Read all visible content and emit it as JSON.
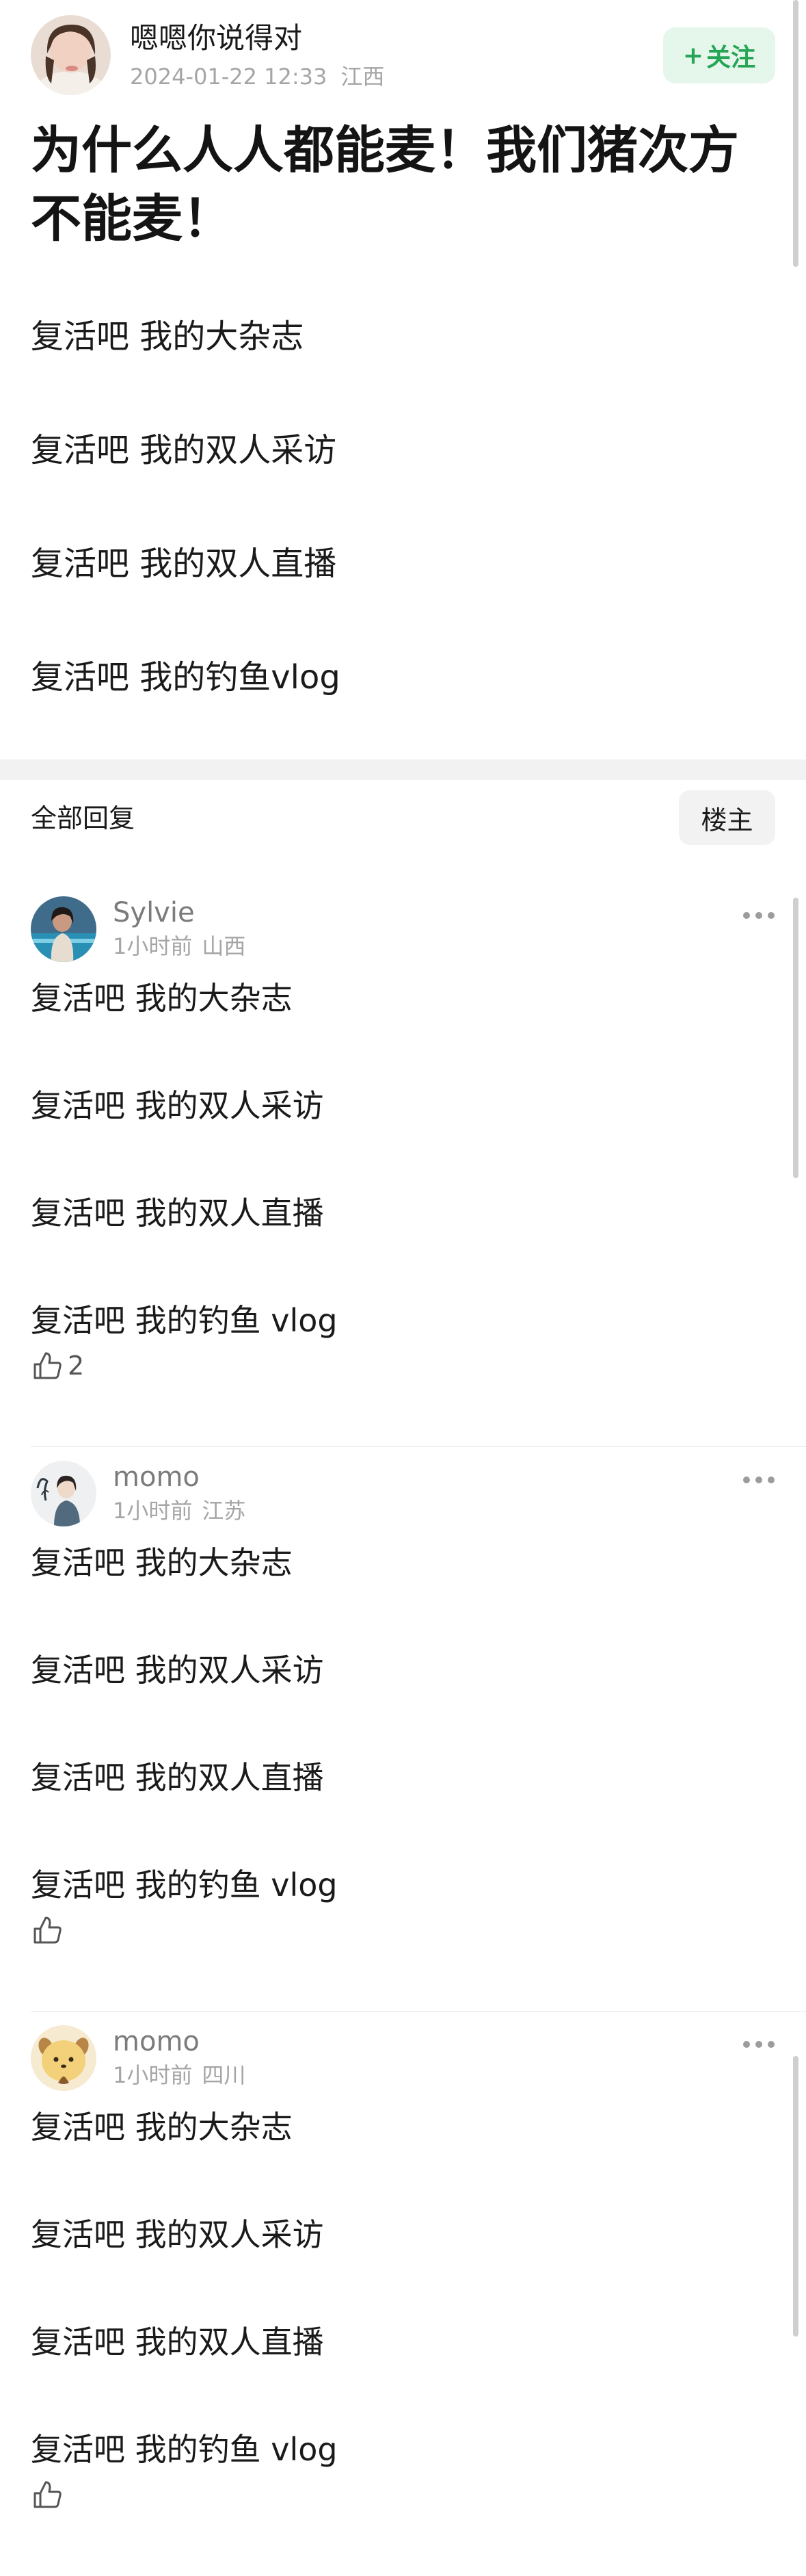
{
  "post": {
    "author": "嗯嗯你说得对",
    "date": "2024-01-22 12:33",
    "location": "江西",
    "follow_label": "关注",
    "follow_plus": "+",
    "title": "为什么人人都能麦！我们猪次方不能麦！",
    "lines": [
      "复活吧 我的大杂志",
      "复活吧 我的双人采访",
      "复活吧 我的双人直播",
      "复活吧 我的钓鱼vlog"
    ]
  },
  "replies": {
    "section_title": "全部回复",
    "op_filter_label": "楼主",
    "items": [
      {
        "author": "Sylvie",
        "time": "1小时前",
        "location": "山西",
        "lines": [
          "复活吧 我的大杂志",
          "复活吧 我的双人采访",
          "复活吧 我的双人直播",
          "复活吧 我的钓鱼 vlog"
        ],
        "likes": "2"
      },
      {
        "author": "momo",
        "time": "1小时前",
        "location": "江苏",
        "lines": [
          "复活吧 我的大杂志",
          "复活吧 我的双人采访",
          "复活吧 我的双人直播",
          "复活吧 我的钓鱼 vlog"
        ],
        "likes": ""
      },
      {
        "author": "momo",
        "time": "1小时前",
        "location": "四川",
        "lines": [
          "复活吧 我的大杂志",
          "复活吧 我的双人采访",
          "复活吧 我的双人直播",
          "复活吧 我的钓鱼 vlog"
        ],
        "likes": ""
      }
    ]
  },
  "icons": {
    "more": "more-icon",
    "like": "thumbs-up-icon",
    "follow": "plus-icon"
  },
  "colors": {
    "follow_text": "#27a556",
    "follow_bg": "#e5f6ea",
    "username": "#7b7b7b",
    "meta": "#a5a5a5",
    "section_bg": "#f2f2f2"
  }
}
